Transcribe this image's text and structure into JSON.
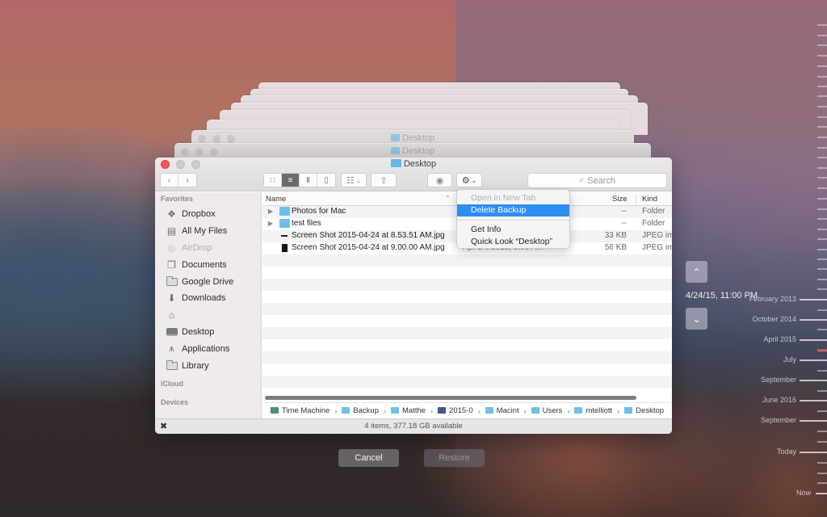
{
  "window": {
    "title": "Desktop",
    "stacked_titles": [
      "Desktop",
      "Desktop"
    ],
    "status": "4 items, 377.18 GB available"
  },
  "toolbar": {
    "back_icon": "chevron-left",
    "forward_icon": "chevron-right",
    "view_modes": [
      "icon-view",
      "list-view",
      "column-view",
      "cover-flow-view"
    ],
    "active_view": "list-view",
    "arrange_icon": "grid-arrange",
    "share_icon": "share",
    "quicklook_icon": "eye",
    "action_icon": "gear",
    "search_placeholder": "Search"
  },
  "sidebar": {
    "sections": [
      {
        "title": "Favorites",
        "items": [
          {
            "label": "Dropbox",
            "icon": "dropbox",
            "dim": false
          },
          {
            "label": "All My Files",
            "icon": "all-files",
            "dim": false
          },
          {
            "label": "AirDrop",
            "icon": "airdrop",
            "dim": true
          },
          {
            "label": "Documents",
            "icon": "documents",
            "dim": false
          },
          {
            "label": "Google Drive",
            "icon": "folder",
            "dim": false
          },
          {
            "label": "Downloads",
            "icon": "downloads",
            "dim": false
          },
          {
            "label": "",
            "icon": "home",
            "dim": false
          },
          {
            "label": "Desktop",
            "icon": "desktop",
            "dim": false
          },
          {
            "label": "Applications",
            "icon": "applications",
            "dim": false
          },
          {
            "label": "Library",
            "icon": "folder",
            "dim": false
          }
        ]
      },
      {
        "title": "iCloud",
        "items": []
      },
      {
        "title": "Devices",
        "items": []
      }
    ]
  },
  "list": {
    "columns": {
      "name": "Name",
      "size": "Size",
      "kind": "Kind"
    },
    "rows": [
      {
        "name": "Photos for Mac",
        "type": "folder",
        "expandable": true,
        "date": "",
        "size": "--",
        "kind": "Folder"
      },
      {
        "name": "test files",
        "type": "folder",
        "expandable": true,
        "date": "",
        "size": "--",
        "kind": "Folder"
      },
      {
        "name": "Screen Shot 2015-04-24 at 8.53.51 AM.jpg",
        "type": "jpg1",
        "expandable": false,
        "date": "",
        "size": "33 KB",
        "kind": "JPEG im"
      },
      {
        "name": "Screen Shot 2015-04-24 at 9.00.00 AM.jpg",
        "type": "jpg2",
        "expandable": false,
        "date": "Apr 24, 2015, 9:00 AM",
        "size": "56 KB",
        "kind": "JPEG im"
      }
    ]
  },
  "path": [
    {
      "label": "Time Machine",
      "icon": "tm"
    },
    {
      "label": "Backup",
      "icon": "folder"
    },
    {
      "label": "Matthe",
      "icon": "folder"
    },
    {
      "label": "2015-0",
      "icon": "comp"
    },
    {
      "label": "Macint",
      "icon": "folder"
    },
    {
      "label": "Users",
      "icon": "folder"
    },
    {
      "label": "mtelliott",
      "icon": "folder"
    },
    {
      "label": "Desktop",
      "icon": "folder"
    }
  ],
  "context_menu": {
    "items": [
      {
        "label": "Open in New Tab",
        "state": "disabled"
      },
      {
        "label": "Delete Backup",
        "state": "selected"
      },
      {
        "separator": true
      },
      {
        "label": "Get Info",
        "state": "normal"
      },
      {
        "label": "Quick Look “Desktop”",
        "state": "normal"
      }
    ]
  },
  "buttons": {
    "cancel": "Cancel",
    "restore": "Restore"
  },
  "time_machine": {
    "current_backup": "4/24/15, 11:00 PM",
    "up_icon": "chevron-up",
    "down_icon": "chevron-down",
    "timeline_labels": [
      "February 2013",
      "October 2014",
      "April 2015",
      "July",
      "September",
      "June 2016",
      "September",
      "Today",
      "Now"
    ]
  },
  "colors": {
    "accent": "#2e8ef0",
    "close_button": "#ed5a57",
    "folder": "#6dc0ec",
    "current_tick": "#e0453d"
  }
}
